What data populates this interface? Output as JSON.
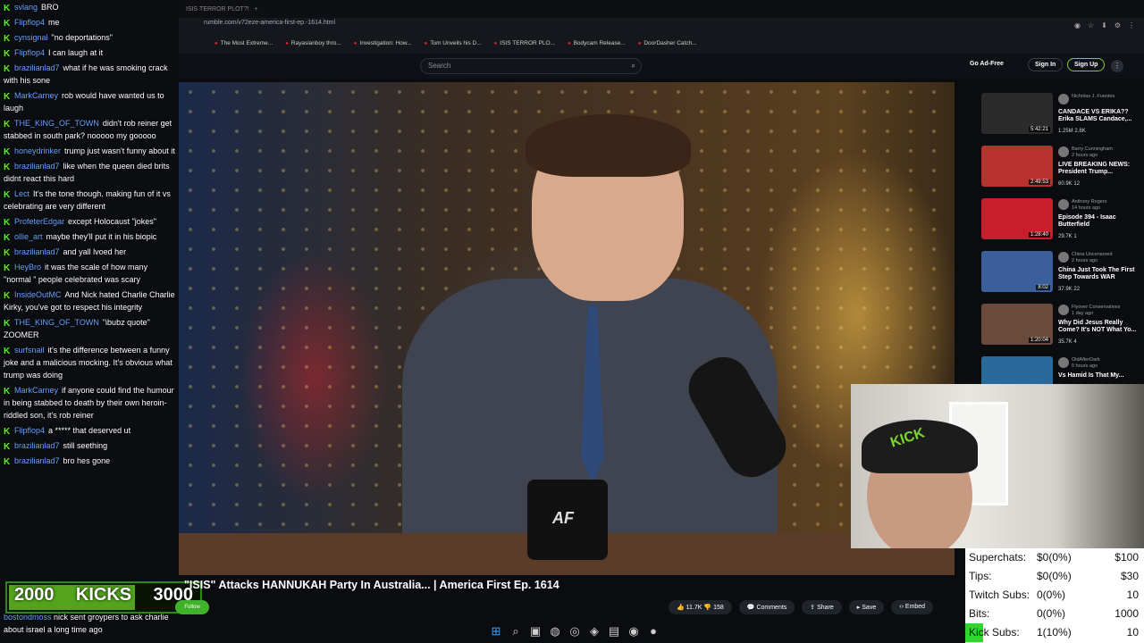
{
  "browser": {
    "tab_title": "ISIS TERROR PLOT?!",
    "url": "rumble.com/v72eze-america-first-ep.-1614.html",
    "bookmarks": [
      "The Most Extreme...",
      "Rayasianboy thro...",
      "Investigation: How...",
      "Tom Unveils his D...",
      "ISIS TERROR PLO...",
      "Bodycam Release...",
      "DoorDasher Catch..."
    ]
  },
  "site": {
    "logo": "rumble",
    "search_placeholder": "Search",
    "go_ad_free": "Go Ad-Free",
    "sign_in": "Sign In",
    "sign_up": "Sign Up"
  },
  "video": {
    "title": "\"ISIS\" Attacks HANNUKAH Party In Australia... | America First Ep. 1614",
    "mug_text": "AF",
    "likes": "11.7K",
    "dislikes": "158",
    "comments_label": "Comments",
    "share_label": "Share",
    "save_label": "Save",
    "embed_label": "Embed"
  },
  "webcam": {
    "cap_text": "KICK"
  },
  "chat": {
    "messages": [
      {
        "user": "svlang",
        "text": "BRO"
      },
      {
        "user": "Flipflop4",
        "text": "me"
      },
      {
        "user": "cynsignal",
        "text": "\"no deportations\""
      },
      {
        "user": "Flipflop4",
        "text": "I can laugh at it"
      },
      {
        "user": "brazilianlad7",
        "text": "what if he was smoking crack with his sone"
      },
      {
        "user": "MarkCarney",
        "text": "rob would have wanted us to laugh"
      },
      {
        "user": "THE_KING_OF_TOWN",
        "text": "didn't rob reiner get stabbed in south park? nooooo my gooooo"
      },
      {
        "user": "honeydrinker",
        "text": "trump just wasn't funny about it"
      },
      {
        "user": "brazilianlad7",
        "text": "like when the queen died brits didnt react this hard"
      },
      {
        "user": "Lect",
        "text": "It's the tone though. making fun of it vs celebrating are very different"
      },
      {
        "user": "ProfeterEdgar",
        "text": "except Holocaust \"jokes\""
      },
      {
        "user": "ollie_art",
        "text": "maybe they'll put it in his biopic"
      },
      {
        "user": "brazilianlad7",
        "text": "and yall lvoed her"
      },
      {
        "user": "HeyBro",
        "text": "it was the scale of how many \"normal \" people celebrated was scary"
      },
      {
        "user": "InsideOutMC",
        "text": "And Nick hated Charlie Charlie Kirky, you've got to respect his integrity"
      },
      {
        "user": "THE_KING_OF_TOWN",
        "text": "\"ibubz quote\" ZOOMER"
      },
      {
        "user": "surfsnail",
        "text": "it's the difference between a funny joke and a malicious mocking. It's obvious what trump was doing"
      },
      {
        "user": "MarkCarney",
        "text": "if anyone could find the humour in being stabbed to death by their own heroin-riddled son, it's rob reiner"
      },
      {
        "user": "Flipflop4",
        "text": "a ***** that deserved ut"
      },
      {
        "user": "brazilianlad7",
        "text": "still seething"
      },
      {
        "user": "brazilianlad7",
        "text": "bro hes gone"
      }
    ],
    "bottom_user": "bostondmoss",
    "bottom_text": "nick sent groypers to ask charlie about israel a long time ago",
    "follow_label": "Follow"
  },
  "kicks_goal": {
    "current": "2000",
    "label": "KICKS",
    "goal": "3000",
    "progress": 0.667
  },
  "recommendations": [
    {
      "channel": "Nicholas J. Fuentes",
      "time": "",
      "title": "CANDACE VS ERIKA?? Erika SLAMS Candace,...",
      "duration": "5:42:21",
      "views": "1.25M",
      "comments": "2.8K",
      "thumb_color": "#2b2b2b"
    },
    {
      "channel": "Barry Cunningham",
      "time": "2 hours ago",
      "title": "LIVE BREAKING NEWS: President Trump...",
      "duration": "2:49:53",
      "views": "60.9K",
      "comments": "12",
      "thumb_color": "#b7322c"
    },
    {
      "channel": "Anthony Rogers",
      "time": "14 hours ago",
      "title": "Episode 394 - Isaac Butterfield",
      "duration": "1:28:40",
      "views": "29.7K",
      "comments": "1",
      "thumb_color": "#c81e2b"
    },
    {
      "channel": "China Uncensored",
      "time": "2 hours ago",
      "title": "China Just Took The First Step Towards WAR",
      "duration": "8:02",
      "views": "37.9K",
      "comments": "22",
      "thumb_color": "#3b5f9a"
    },
    {
      "channel": "Flyover Conservatives",
      "time": "1 day ago",
      "title": "Why Did Jesus Really Come? It's NOT What Yo...",
      "duration": "1:20:04",
      "views": "35.7K",
      "comments": "4",
      "thumb_color": "#6a4a3a"
    },
    {
      "channel": "OldAfterDark",
      "time": "5 hours ago",
      "title": "Vs Hamid Is That My...",
      "duration": "",
      "views": "",
      "comments": "",
      "thumb_color": "#2a6a9a"
    }
  ],
  "stats_panel": {
    "rows": [
      {
        "label": "Superchats:",
        "value": "$0(0%)",
        "goal": "$100"
      },
      {
        "label": "Tips:",
        "value": "$0(0%)",
        "goal": "$30"
      },
      {
        "label": "Twitch Subs:",
        "value": "0(0%)",
        "goal": "10"
      },
      {
        "label": "Bits:",
        "value": "0(0%)",
        "goal": "1000"
      },
      {
        "label": "Kick Subs:",
        "value": "1(10%)",
        "goal": "10"
      }
    ],
    "kick_subs_progress": 0.1,
    "bar_color": "#2ed62e"
  },
  "taskbar": [
    "windows-start",
    "search",
    "task-view",
    "discord",
    "chrome",
    "brave",
    "files",
    "spotify",
    "obs"
  ]
}
